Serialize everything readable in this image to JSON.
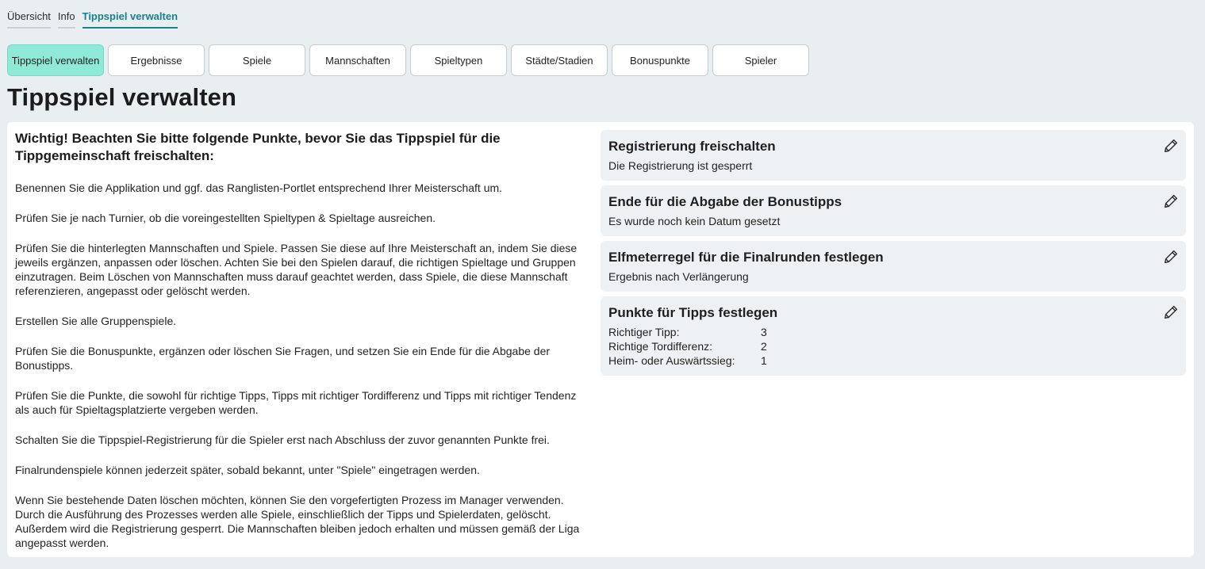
{
  "top_tabs": [
    {
      "label": "Übersicht"
    },
    {
      "label": "Info"
    },
    {
      "label": "Tippspiel verwalten"
    }
  ],
  "subnav": [
    {
      "label": "Tippspiel verwalten"
    },
    {
      "label": "Ergebnisse"
    },
    {
      "label": "Spiele"
    },
    {
      "label": "Mannschaften"
    },
    {
      "label": "Spieltypen"
    },
    {
      "label": "Städte/Stadien"
    },
    {
      "label": "Bonuspunkte"
    },
    {
      "label": "Spieler"
    }
  ],
  "page_title": "Tippspiel verwalten",
  "instructions": {
    "heading": "Wichtig! Beachten Sie bitte folgende Punkte, bevor Sie das Tippspiel für die Tippgemeinschaft freischalten:",
    "paragraphs": [
      "Benennen Sie die Applikation und ggf. das Ranglisten-Portlet entsprechend Ihrer Meisterschaft um.",
      "Prüfen Sie je nach Turnier, ob die voreingestellten Spieltypen & Spieltage ausreichen.",
      "Prüfen Sie die hinterlegten Mannschaften und Spiele. Passen Sie diese auf Ihre Meisterschaft an, indem Sie diese jeweils ergänzen, anpassen oder löschen. Achten Sie bei den Spielen darauf, die richtigen Spieltage und Gruppen einzutragen. Beim Löschen von Mannschaften muss darauf geachtet werden, dass Spiele, die diese Mannschaft referenzieren, angepasst oder gelöscht werden.",
      "Erstellen Sie alle Gruppenspiele.",
      "Prüfen Sie die Bonuspunkte, ergänzen oder löschen Sie Fragen, und setzen Sie ein Ende für die Abgabe der Bonustipps.",
      "Prüfen Sie die Punkte, die sowohl für richtige Tipps, Tipps mit richtiger Tordifferenz und Tipps mit richtiger Tendenz als auch für Spieltagsplatzierte vergeben werden.",
      "Schalten Sie die Tippspiel-Registrierung für die Spieler erst nach Abschluss der zuvor genannten Punkte frei.",
      "Finalrundenspiele können jederzeit später, sobald bekannt, unter \"Spiele\" eingetragen werden.",
      "Wenn Sie bestehende Daten löschen möchten, können Sie den vorgefertigten Prozess im Manager verwenden. Durch die Ausführung des Prozesses werden alle Spiele, einschließlich der Tipps und Spielerdaten, gelöscht. Außerdem wird die Registrierung gesperrt. Die Mannschaften bleiben jedoch erhalten und müssen gemäß der Liga angepasst werden."
    ]
  },
  "settings": {
    "registration": {
      "title": "Registrierung freischalten",
      "value": "Die Registrierung ist gesperrt"
    },
    "bonus_deadline": {
      "title": "Ende für die Abgabe der Bonustipps",
      "value": "Es wurde noch kein Datum gesetzt"
    },
    "penalty_rule": {
      "title": "Elfmeterregel für die Finalrunden festlegen",
      "value": "Ergebnis nach Verlängerung"
    },
    "points": {
      "title": "Punkte für Tipps festlegen",
      "rows": [
        {
          "label": "Richtiger Tipp:",
          "value": "3"
        },
        {
          "label": "Richtige Tordifferenz:",
          "value": "2"
        },
        {
          "label": "Heim- oder Auswärtssieg:",
          "value": "1"
        }
      ]
    }
  },
  "icons": {
    "edit": "pencil-icon"
  },
  "colors": {
    "accent": "#1a7f8c",
    "active_button": "#8eead6",
    "background": "#e9eef1"
  }
}
